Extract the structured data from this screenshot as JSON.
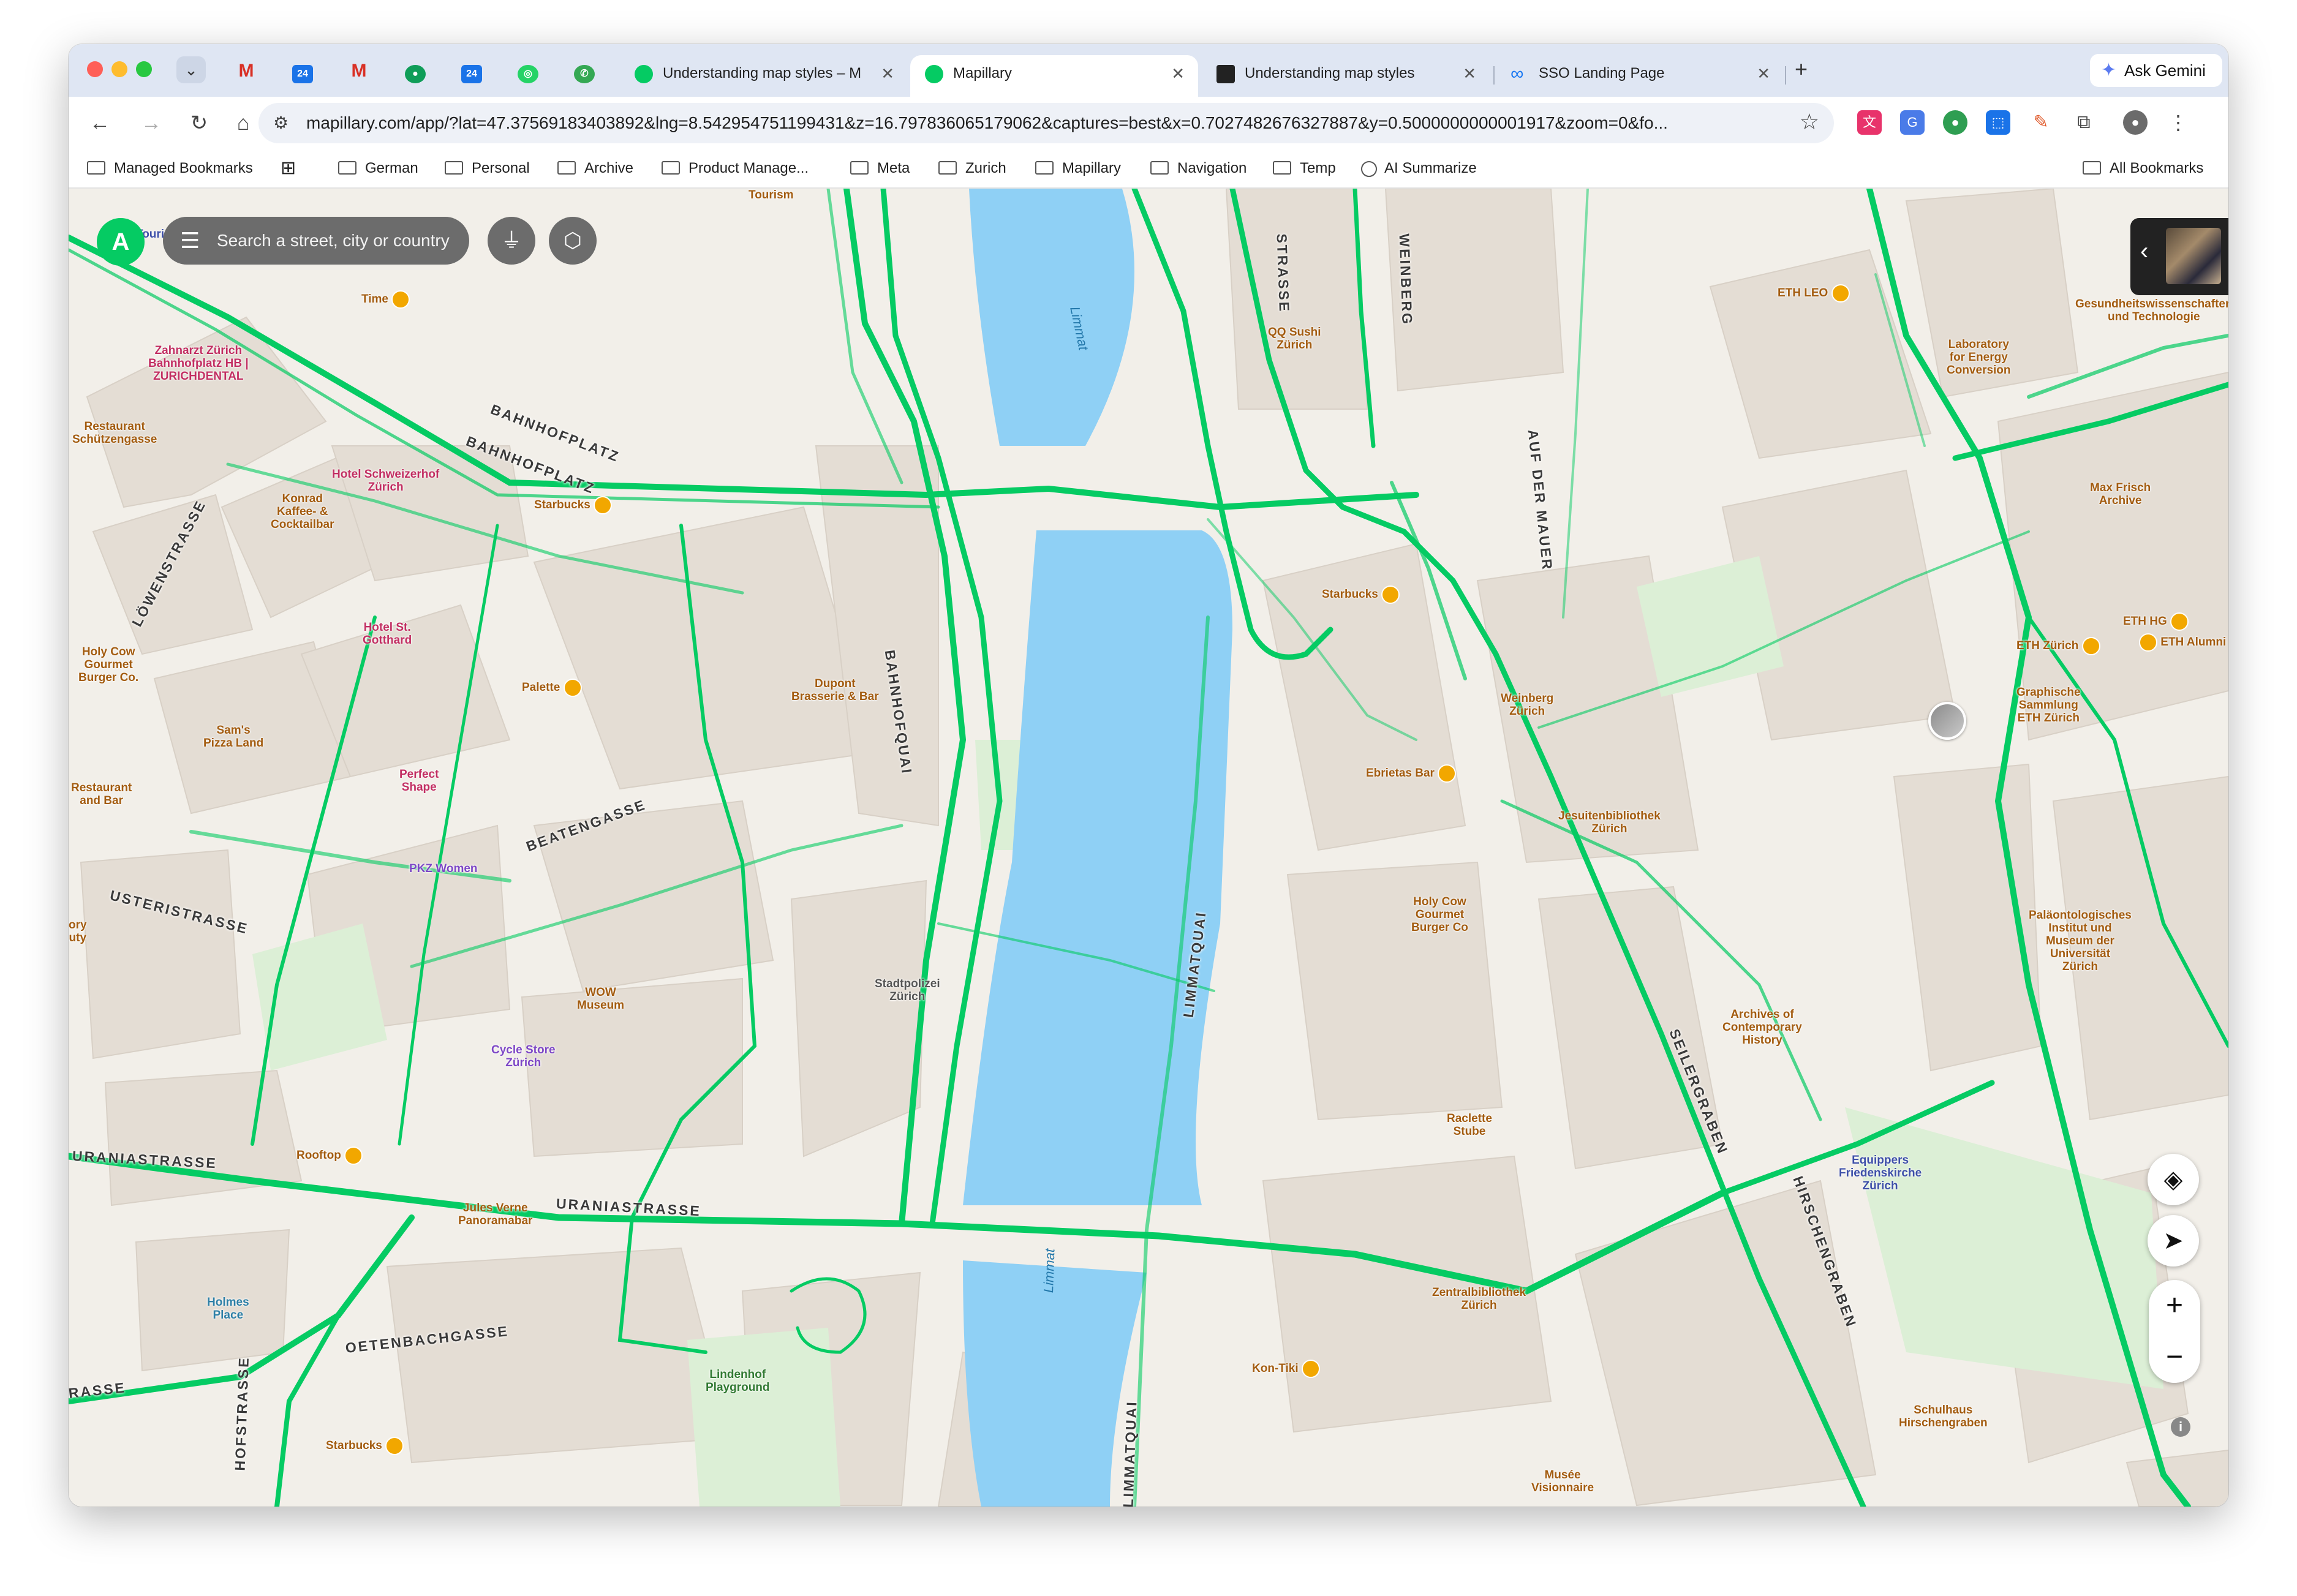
{
  "browser": {
    "pinned_tabs": [
      {
        "icon": "gmail-icon",
        "label": "M",
        "color": "#d93025"
      },
      {
        "icon": "calendar-icon",
        "label": "24",
        "color": "#1a73e8"
      },
      {
        "icon": "gmail-icon",
        "label": "M",
        "color": "#d93025"
      },
      {
        "icon": "app-icon",
        "label": "●",
        "color": "#0f9d58"
      },
      {
        "icon": "calendar-icon",
        "label": "24",
        "color": "#1a73e8"
      },
      {
        "icon": "whatsapp-icon",
        "label": "◎",
        "color": "#25d366"
      },
      {
        "icon": "phone-icon",
        "label": "✆",
        "color": "#34a853"
      }
    ],
    "tabs": [
      {
        "title": "Understanding map styles – M",
        "active": false,
        "favicon_color": "#05cb63"
      },
      {
        "title": "Mapillary",
        "active": true,
        "favicon_color": "#05cb63"
      },
      {
        "title": "Understanding map styles",
        "active": false,
        "favicon_color": "#222222"
      },
      {
        "title": "SSO Landing Page",
        "active": false,
        "favicon_color": "#1877f2"
      }
    ],
    "ask_gemini": "Ask Gemini",
    "url": "mapillary.com/app/?lat=47.37569183403892&lng=8.542954751199431&z=16.797836065179062&captures=best&x=0.7027482676327887&y=0.5000000000001917&zoom=0&fo...",
    "bookmarks": [
      "Managed Bookmarks",
      "German",
      "Personal",
      "Archive",
      "Product Manage...",
      "Meta",
      "Zurich",
      "Mapillary",
      "Navigation",
      "Temp",
      "AI Summarize"
    ],
    "all_bookmarks": "All Bookmarks"
  },
  "mapillary": {
    "search_placeholder": "Search a street, city or country",
    "logo_label": "A",
    "filter_icon": "filter-icon",
    "layers_icon": "layers-icon",
    "locate_icon": "navigation-arrow-icon",
    "zoom_in": "+",
    "zoom_out": "−",
    "info": "i"
  },
  "map": {
    "colors": {
      "coverage": "#05cb63",
      "water": "#8fd0f5",
      "building": "#e3dcd4",
      "land": "#f2efe9"
    },
    "streets": [
      "BAHNHOFPLATZ",
      "BAHNHOFPLATZ",
      "LÖWENSTRASSE",
      "BAHNHOFQUAI",
      "BEATENGASSE",
      "USTERISTRASSE",
      "URANIASTRASSE",
      "URANIASTRASSE",
      "OETENBACHGASSE",
      "RASSE",
      "LIMMATQUAI",
      "SEILERGRABEN",
      "HIRSCHENGRABEN",
      "AUF DER MAUER",
      "STRASSE",
      "WEINBERG",
      "HOFSTRASSE",
      "LIMMATQUAI"
    ],
    "water_labels": [
      "Limmat",
      "Limmat"
    ],
    "pois": [
      {
        "name": "Tourism",
        "kind": "orange"
      },
      {
        "name": "Tourist Info",
        "kind": "blue"
      },
      {
        "name": "Time",
        "kind": "orange"
      },
      {
        "name": "Zahnarzt Zürich\nBahnhofplatz HB |\nZURICHDENTAL",
        "kind": "pink"
      },
      {
        "name": "Restaurant\nSchützengasse",
        "kind": "orange"
      },
      {
        "name": "Hotel Schweizerhof\nZürich",
        "kind": "pink"
      },
      {
        "name": "Starbucks",
        "kind": "orange"
      },
      {
        "name": "Konrad\nKaffee- &\nCocktailbar",
        "kind": "orange"
      },
      {
        "name": "Hotel St.\nGotthard",
        "kind": "pink"
      },
      {
        "name": "Holy Cow\nGourmet\nBurger Co.",
        "kind": "orange"
      },
      {
        "name": "Palette",
        "kind": "orange"
      },
      {
        "name": "Sam's\nPizza Land",
        "kind": "orange"
      },
      {
        "name": "Dupont\nBrasserie & Bar",
        "kind": "orange"
      },
      {
        "name": "Restaurant\nand Bar",
        "kind": "orange"
      },
      {
        "name": "Perfect\nShape",
        "kind": "pink"
      },
      {
        "name": "PKZ Women",
        "kind": "purple"
      },
      {
        "name": "WOW\nMuseum",
        "kind": "orange"
      },
      {
        "name": "Stadtpolizei\nZürich",
        "kind": "gray"
      },
      {
        "name": "Cycle Store\nZürich",
        "kind": "purple"
      },
      {
        "name": "Rooftop",
        "kind": "orange"
      },
      {
        "name": "Jules Verne\nPanoramabar",
        "kind": "orange"
      },
      {
        "name": "Holmes\nPlace",
        "kind": "teal"
      },
      {
        "name": "Lindenhof\nPlayground",
        "kind": "green"
      },
      {
        "name": "Starbucks",
        "kind": "orange"
      },
      {
        "name": "QQ Sushi\nZürich",
        "kind": "orange"
      },
      {
        "name": "Starbucks",
        "kind": "orange"
      },
      {
        "name": "ETH LEO",
        "kind": "orange"
      },
      {
        "name": "Gesundheitswissenschaften\nund Technologie",
        "kind": "orange"
      },
      {
        "name": "Laboratory\nfor Energy\nConversion",
        "kind": "orange"
      },
      {
        "name": "Max Frisch\nArchive",
        "kind": "orange"
      },
      {
        "name": "ETH HG",
        "kind": "orange"
      },
      {
        "name": "ETH Zürich",
        "kind": "orange"
      },
      {
        "name": "ETH Alumni",
        "kind": "orange"
      },
      {
        "name": "Graphische\nSammlung\nETH Zürich",
        "kind": "orange"
      },
      {
        "name": "Weinberg\nZürich",
        "kind": "orange"
      },
      {
        "name": "Ebrietas Bar",
        "kind": "orange"
      },
      {
        "name": "Jesuitenbibliothek\nZürich",
        "kind": "orange"
      },
      {
        "name": "Holy Cow\nGourmet\nBurger Co",
        "kind": "orange"
      },
      {
        "name": "Paläontologisches\nInstitut und\nMuseum der\nUniversität\nZürich",
        "kind": "orange"
      },
      {
        "name": "Archives of\nContemporary\nHistory",
        "kind": "orange"
      },
      {
        "name": "Raclette\nStube",
        "kind": "orange"
      },
      {
        "name": "Equippers\nFriedenskirche\nZürich",
        "kind": "blue"
      },
      {
        "name": "Zentralbibliothek\nZürich",
        "kind": "orange"
      },
      {
        "name": "Kon-Tiki",
        "kind": "orange"
      },
      {
        "name": "Schulhaus\nHirschengraben",
        "kind": "orange"
      },
      {
        "name": "Musée\nVisionnaire",
        "kind": "orange"
      },
      {
        "name": "ory\nuty",
        "kind": "orange"
      }
    ]
  }
}
